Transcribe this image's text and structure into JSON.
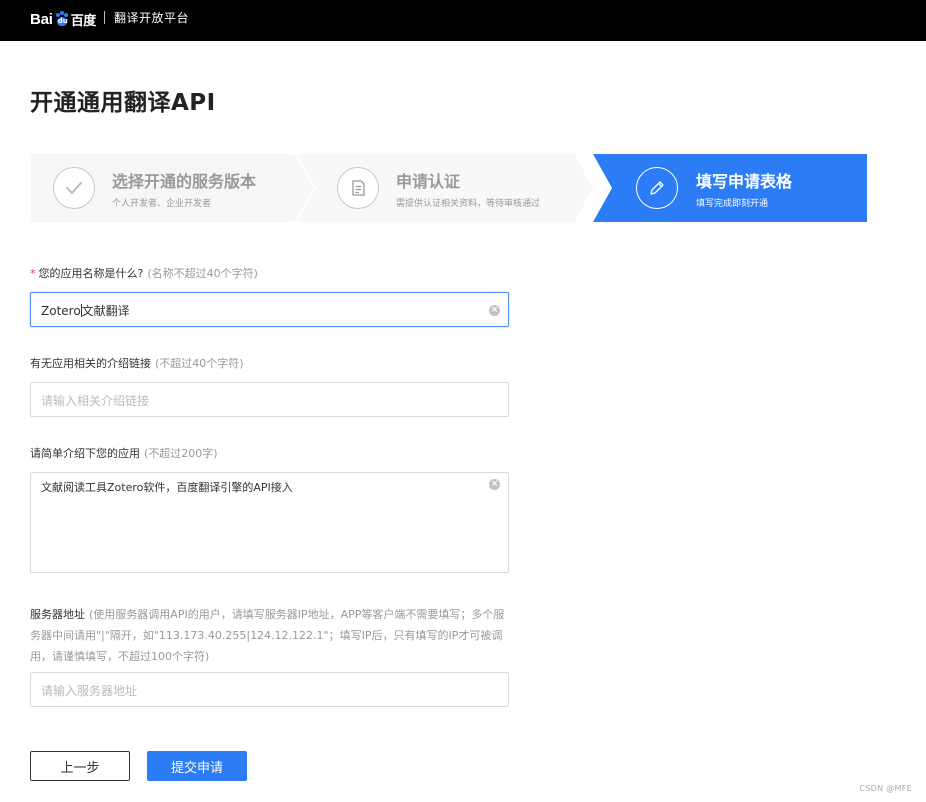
{
  "header": {
    "logo_text_latin": "Bai",
    "logo_paw_text": "du",
    "logo_text_cn": "百度",
    "platform_name": "翻译开放平台"
  },
  "page_title": "开通通用翻译API",
  "steps": [
    {
      "title": "选择开通的服务版本",
      "subtitle": "个人开发者、企业开发者",
      "icon": "check-icon",
      "state": "done"
    },
    {
      "title": "申请认证",
      "subtitle": "需提供认证相关资料，等待审核通过",
      "icon": "document-icon",
      "state": "done"
    },
    {
      "title": "填写申请表格",
      "subtitle": "填写完成即刻开通",
      "icon": "pencil-icon",
      "state": "active"
    }
  ],
  "form": {
    "app_name": {
      "required_mark": "*",
      "label": "您的应用名称是什么?",
      "hint": "(名称不超过40个字符)",
      "value_before_caret": "Zotero",
      "value_after_caret": "文献翻译"
    },
    "intro_link": {
      "label": "有无应用相关的介绍链接",
      "hint": "(不超过40个字符)",
      "placeholder": "请输入相关介绍链接"
    },
    "app_desc": {
      "label": "请简单介绍下您的应用",
      "hint": "(不超过200字)",
      "value": "文献阅读工具Zotero软件，百度翻译引擎的API接入"
    },
    "server_address": {
      "label": "服务器地址",
      "hint": "(使用服务器调用API的用户，请填写服务器IP地址，APP等客户端不需要填写；多个服务器中间请用\"|\"隔开，如\"113.173.40.255|124.12.122.1\"；填写IP后，只有填写的IP才可被调用，请谨慎填写，不超过100个字符)",
      "placeholder": "请输入服务器地址"
    }
  },
  "buttons": {
    "prev": "上一步",
    "submit": "提交申请"
  },
  "watermark": "CSDN @MFE",
  "colors": {
    "accent": "#2c7cf6",
    "step_inactive_bg": "#f5f6f7",
    "header_bg": "#000000"
  }
}
